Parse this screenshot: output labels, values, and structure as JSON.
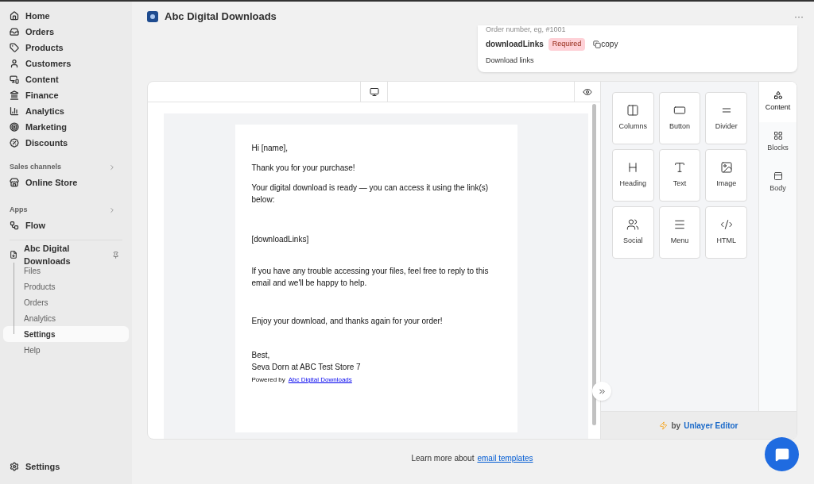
{
  "sidebar": {
    "items": [
      {
        "label": "Home"
      },
      {
        "label": "Orders"
      },
      {
        "label": "Products"
      },
      {
        "label": "Customers"
      },
      {
        "label": "Content"
      },
      {
        "label": "Finance"
      },
      {
        "label": "Analytics"
      },
      {
        "label": "Marketing"
      },
      {
        "label": "Discounts"
      }
    ],
    "sales_channels": {
      "heading": "Sales channels",
      "items": [
        {
          "label": "Online Store"
        }
      ]
    },
    "apps": {
      "heading": "Apps",
      "items": [
        {
          "label": "Flow"
        }
      ]
    },
    "app": {
      "label": "Abc Digital Downloads",
      "children": [
        {
          "label": "Files",
          "selected": false
        },
        {
          "label": "Products",
          "selected": false
        },
        {
          "label": "Orders",
          "selected": false
        },
        {
          "label": "Analytics",
          "selected": false
        },
        {
          "label": "Settings",
          "selected": true
        },
        {
          "label": "Help",
          "selected": false
        }
      ]
    },
    "footer_item": {
      "label": "Settings"
    }
  },
  "header": {
    "title": "Abc Digital Downloads",
    "more": "···"
  },
  "variables_card": {
    "order_hint": "Order number, eg, #1001",
    "variable": "downloadLinks",
    "badge": "Required",
    "copy": "copy",
    "description": "Download links"
  },
  "email": {
    "paragraphs": [
      "Hi [name],",
      "Thank you for your purchase!",
      "Your digital download is ready — you can access it using the link(s) below:",
      "[downloadLinks]",
      "If you have any trouble accessing your files, feel free to reply to this email and we'll be happy to help.",
      "Enjoy your download, and thanks again for your order!"
    ],
    "signoff": "Best,",
    "signature": "Seva Dorn at ABC Test Store 7",
    "powered_prefix": "Powered by",
    "powered_link": "Abc Digital Downloads"
  },
  "tools": [
    {
      "label": "Columns"
    },
    {
      "label": "Button"
    },
    {
      "label": "Divider"
    },
    {
      "label": "Heading"
    },
    {
      "label": "Text"
    },
    {
      "label": "Image"
    },
    {
      "label": "Social"
    },
    {
      "label": "Menu"
    },
    {
      "label": "HTML"
    }
  ],
  "panel_tabs": [
    {
      "label": "Content",
      "selected": true
    },
    {
      "label": "Blocks",
      "selected": false
    },
    {
      "label": "Body",
      "selected": false
    }
  ],
  "branding": {
    "prefix": "by",
    "name": "Unlayer Editor"
  },
  "footer": {
    "text": "Learn more about",
    "link": "email templates"
  }
}
